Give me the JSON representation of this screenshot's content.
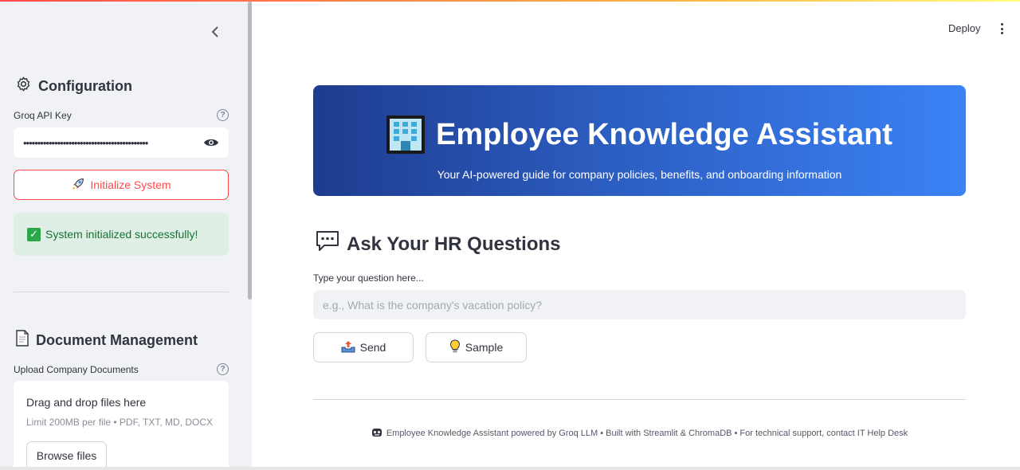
{
  "header": {
    "deploy_label": "Deploy",
    "menu_icon": "more-vertical-icon"
  },
  "sidebar": {
    "collapse_icon": "chevron-left-icon",
    "configuration": {
      "heading": "Configuration",
      "icon": "gear-icon",
      "api_key_label": "Groq API Key",
      "api_key_value": "••••••••••••••••••••••••••••••••••••••••••••",
      "initialize_label": "Initialize System",
      "success_message": "System initialized successfully!"
    },
    "documents": {
      "heading": "Document Management",
      "icon": "document-icon",
      "upload_label": "Upload Company Documents",
      "drop_text": "Drag and drop files here",
      "limit_text": "Limit 200MB per file • PDF, TXT, MD, DOCX",
      "browse_label": "Browse files"
    }
  },
  "banner": {
    "title": "Employee Knowledge Assistant",
    "subtitle": "Your AI-powered guide for company policies, benefits, and onboarding information",
    "icon": "office-building-icon"
  },
  "ask": {
    "heading": "Ask Your HR Questions",
    "icon": "speech-balloon-icon",
    "question_label": "Type your question here...",
    "question_placeholder": "e.g., What is the company's vacation policy?",
    "question_value": "",
    "send_label": "Send",
    "sample_label": "Sample"
  },
  "footer": {
    "text": "Employee Knowledge Assistant powered by Groq LLM • Built with Streamlit & ChromaDB • For technical support, contact IT Help Desk"
  },
  "colors": {
    "accent": "#ff4b4b",
    "success_bg": "#dfefe6",
    "success_text": "#177233",
    "banner_start": "#1e3c8f",
    "banner_end": "#3b82f6"
  }
}
